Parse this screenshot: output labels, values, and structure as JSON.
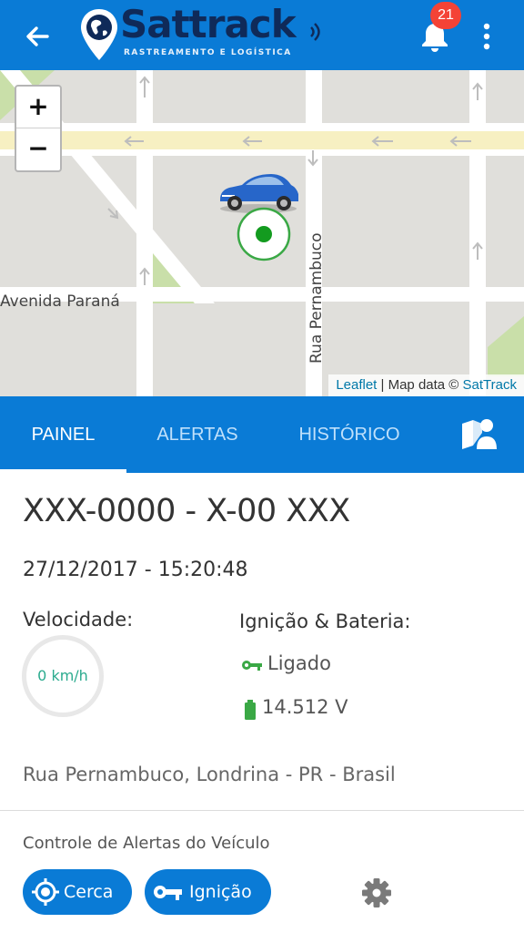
{
  "appbar": {
    "brand_name": "Sattrack",
    "brand_tagline": "RASTREAMENTO E LOGÍSTICA",
    "notification_count": "21",
    "icons": [
      "back-arrow-icon",
      "globe-pin-icon",
      "bell-icon",
      "more-vert-icon"
    ]
  },
  "map": {
    "zoom_in": "+",
    "zoom_out": "−",
    "streets": [
      "Avenida Paraná",
      "Rua Pernambuco"
    ],
    "attribution": {
      "leaflet": "Leaflet",
      "separator": " | Map data © ",
      "provider": "SatTrack"
    }
  },
  "tabs": {
    "items": [
      {
        "label": "PAINEL",
        "active": true
      },
      {
        "label": "ALERTAS",
        "active": false
      },
      {
        "label": "HISTÓRICO",
        "active": false
      }
    ],
    "extra_icon": "map-person-icon"
  },
  "vehicle": {
    "plate": "XXX-0000 - X-00 XXX",
    "timestamp": "27/12/2017 - 15:20:48",
    "speed_label": "Velocidade:",
    "speed_value": "0 km/h",
    "ignition_label": "Ignição & Bateria:",
    "ignition_status": "Ligado",
    "battery_voltage": "14.512 V",
    "address": "Rua Pernambuco, Londrina - PR - Brasil"
  },
  "alert_controls": {
    "title": "Controle de Alertas do Veículo",
    "buttons": [
      {
        "label": "Cerca",
        "icon": "crosshair-icon"
      },
      {
        "label": "Ignição",
        "icon": "key-icon"
      }
    ],
    "settings_icon": "gear-icon"
  },
  "colors": {
    "primary": "#0a7bd6",
    "badge": "#f44336",
    "ok_green": "#3aa845",
    "speed_text": "#2bab8e"
  }
}
